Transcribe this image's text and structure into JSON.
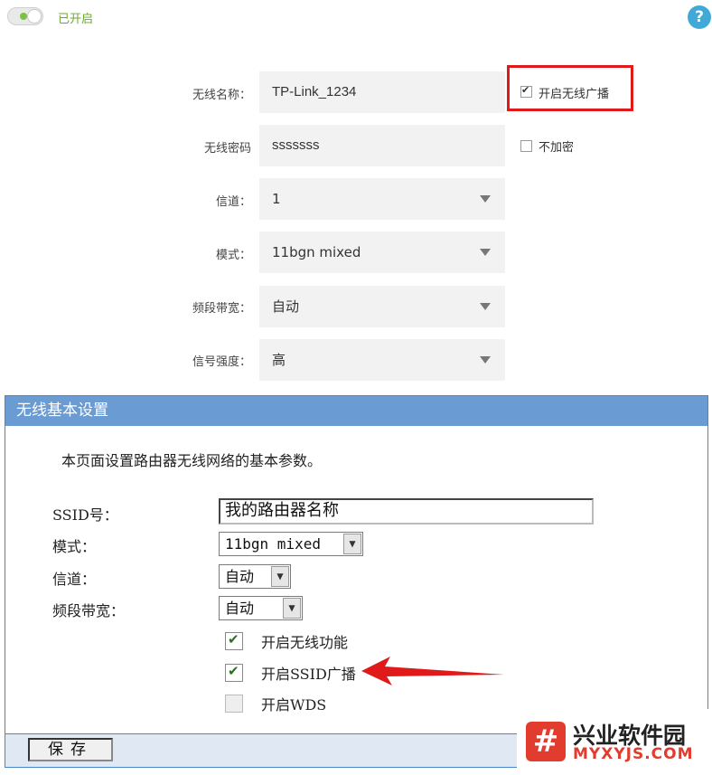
{
  "top": {
    "status_label": "已开启",
    "help_glyph": "?",
    "fields": [
      {
        "label": "无线名称：",
        "value": "TP-Link_1234"
      },
      {
        "label": "无线密码",
        "value": "sssssss"
      },
      {
        "label": "信道：",
        "value": "1"
      },
      {
        "label": "模式：",
        "value": "11bgn mixed"
      },
      {
        "label": "频段带宽：",
        "value": "自动"
      },
      {
        "label": "信号强度：",
        "value": "高"
      }
    ],
    "broadcast_label": "开启无线广播",
    "no_encrypt_label": "不加密",
    "highlight_color": "#e01a1a"
  },
  "old": {
    "header": "无线基本设置",
    "description": "本页面设置路由器无线网络的基本参数。",
    "ssid_label": "SSID号：",
    "ssid_value": "我的路由器名称",
    "mode_label": "模式：",
    "mode_value": "11bgn mixed",
    "channel_label": "信道：",
    "channel_value": "自动",
    "bandwidth_label": "频段带宽：",
    "bandwidth_value": "自动",
    "options": [
      {
        "label": "开启无线功能",
        "checked": true
      },
      {
        "label": "开启SSID广播",
        "checked": true
      },
      {
        "label": "开启WDS",
        "checked": false
      }
    ],
    "save_label": "保存",
    "arrow_color": "#e01a1a"
  },
  "watermark": {
    "logo_glyph": "#",
    "title": "兴业软件园",
    "url": "MYXYJS.COM"
  }
}
